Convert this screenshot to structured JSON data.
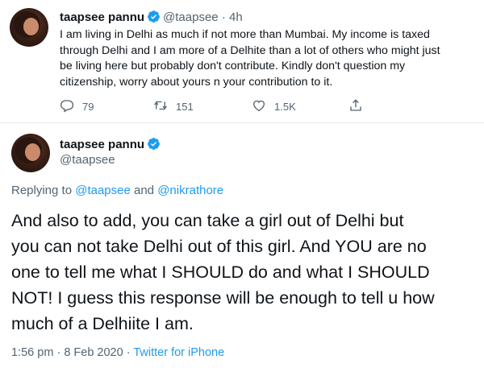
{
  "tweet1": {
    "name": "taapsee pannu",
    "handle": "@taapsee",
    "separator": "·",
    "time": "4h",
    "text": "I am living in Delhi as much if not more than Mumbai. My income is taxed\nthrough Delhi and I am more of a Delhite than a lot of others who might just\nbe living here but probably don't contribute. Kindly don't question my\ncitizenship, worry about yours n your contribution to it.",
    "replies": "79",
    "retweets": "151",
    "likes": "1.5K"
  },
  "tweet2": {
    "name": "taapsee pannu",
    "handle": "@taapsee",
    "replying_prefix": "Replying to",
    "reply_to_1": "@taapsee",
    "and": "and",
    "reply_to_2": "@nikrathore",
    "text": "And also to add, you can take a girl out of Delhi but\nyou can not take Delhi out of this girl. And YOU are no\none to tell me what I SHOULD do and what I SHOULD\nNOT! I guess this response will be enough to tell u how\nmuch of a Delhiite I am.",
    "time": "1:56 pm",
    "dot": "·",
    "date": "8 Feb 2020",
    "source": "Twitter for iPhone"
  },
  "icons": {
    "verified": "verified-badge-icon",
    "reply": "reply-icon",
    "retweet": "retweet-icon",
    "like": "heart-icon",
    "share": "share-icon"
  },
  "colors": {
    "accent": "#1d9bf0",
    "muted": "#536471",
    "text": "#0f1419"
  }
}
